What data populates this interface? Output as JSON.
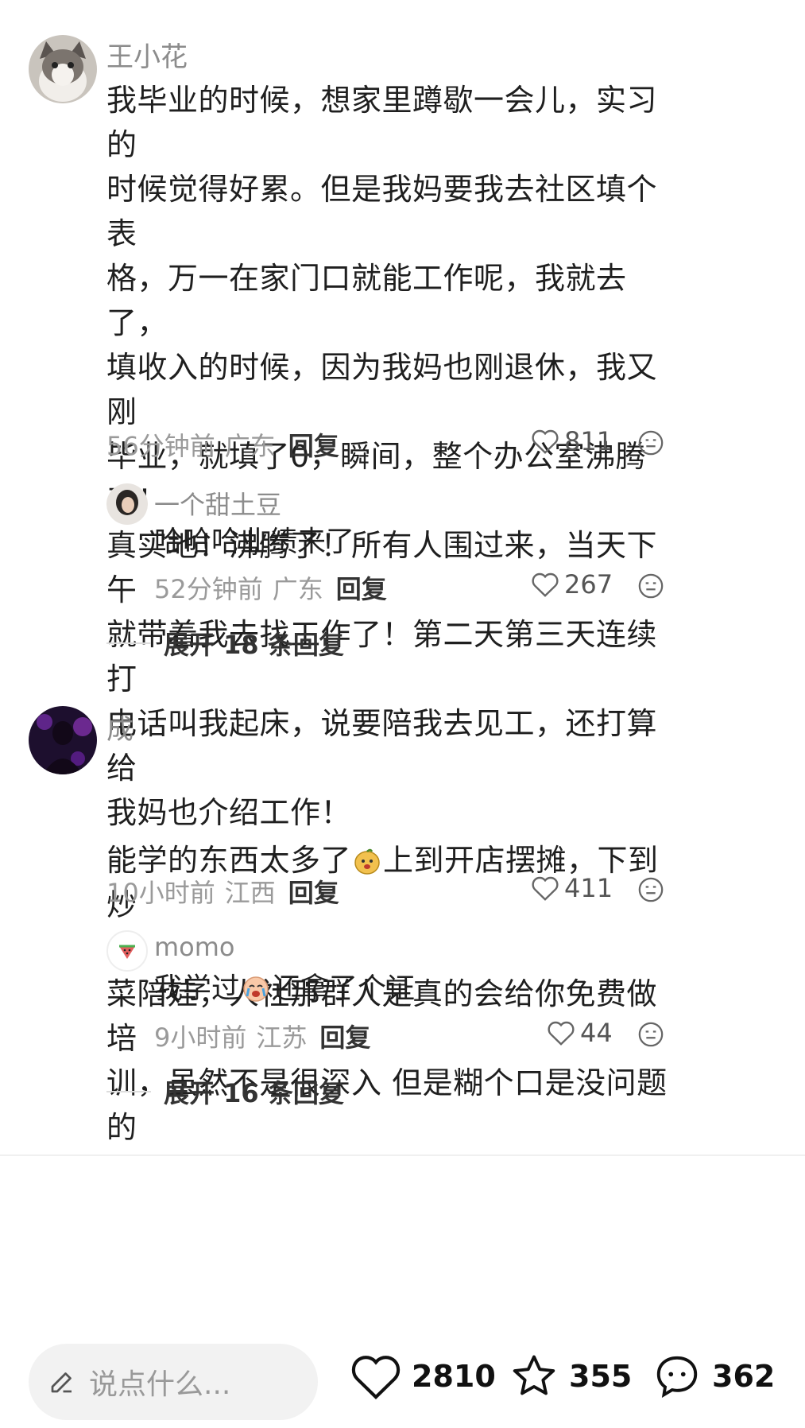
{
  "comments": [
    {
      "user": "王小花",
      "text": "我毕业的时候，想家里蹲歇一会儿，实习的\n时候觉得好累。但是我妈要我去社区填个表\n格，万一在家门口就能工作呢，我就去了，\n填收入的时候，因为我妈也刚退休，我又刚\n毕业，就填了0，瞬间，整个办公室沸腾了！\n真实地！沸腾了！所有人围过来，当天下午\n就带着我去找工作了！第二天第三天连续打\n电话叫我起床，说要陪我去见工，还打算给\n我妈也介绍工作！",
      "time": "56分钟前",
      "location": "广东",
      "reply_label": "回复",
      "likes": "811",
      "replies": [
        {
          "user": "一个甜土豆",
          "text": "哈哈哈业绩来了",
          "time": "52分钟前",
          "location": "广东",
          "reply_label": "回复",
          "likes": "267"
        }
      ],
      "expand_label": "展开 18 条回复"
    },
    {
      "user": "成",
      "text_line1_a": "能学的东西太多了",
      "text_line1_b": "上到开店摆摊，下到炒",
      "text_rest": "菜陪娃，人社那群人是真的会给你免费做培\n训，虽然不是很深入 但是糊个口是没问题的",
      "time": "10小时前",
      "location": "江西",
      "reply_label": "回复",
      "likes": "411",
      "replies": [
        {
          "user": "momo",
          "text_a": "我学过",
          "text_b": "还拿了个证",
          "time": "9小时前",
          "location": "江苏",
          "reply_label": "回复",
          "likes": "44"
        }
      ],
      "expand_label": "展开 16 条回复"
    }
  ],
  "bottom_bar": {
    "placeholder": "说点什么...",
    "like_count": "2810",
    "fav_count": "355",
    "comment_count": "362"
  },
  "colors": {
    "meta": "#9a9a9a",
    "username": "#8c8c8c",
    "composer_bg": "#f2f2f2"
  }
}
